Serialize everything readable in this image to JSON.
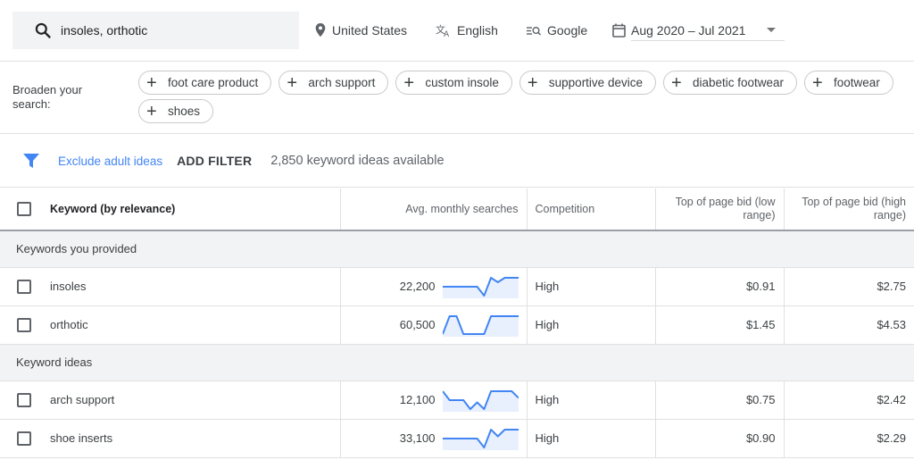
{
  "search": {
    "value": "insoles, orthotic",
    "icon": "search-icon"
  },
  "settings": {
    "location": "United States",
    "language": "English",
    "network": "Google",
    "date_range": "Aug 2020 – Jul 2021"
  },
  "broaden": {
    "label": "Broaden your search:",
    "chips": [
      "foot care product",
      "arch support",
      "custom insole",
      "supportive device",
      "diabetic footwear",
      "footwear",
      "shoes"
    ]
  },
  "filters": {
    "exclude_label": "Exclude adult ideas",
    "add_filter_label": "ADD FILTER",
    "count_text": "2,850 keyword ideas available"
  },
  "table": {
    "headers": {
      "keyword": "Keyword (by relevance)",
      "searches": "Avg. monthly searches",
      "competition": "Competition",
      "bid_low": "Top of page bid (low range)",
      "bid_high": "Top of page bid (high range)"
    },
    "groups": [
      {
        "title": "Keywords you provided",
        "rows": [
          {
            "keyword": "insoles",
            "searches": "22,200",
            "trend": [
              2,
              2,
              2,
              2,
              2,
              2,
              0,
              4,
              3,
              4,
              4,
              4
            ],
            "competition": "High",
            "bid_low": "$0.91",
            "bid_high": "$2.75"
          },
          {
            "keyword": "orthotic",
            "searches": "60,500",
            "trend": [
              1,
              4,
              4,
              1,
              1,
              1,
              1,
              4,
              4,
              4,
              4,
              4
            ],
            "competition": "High",
            "bid_low": "$1.45",
            "bid_high": "$4.53"
          }
        ]
      },
      {
        "title": "Keyword ideas",
        "rows": [
          {
            "keyword": "arch support",
            "searches": "12,100",
            "trend": [
              5,
              3,
              3,
              3,
              1,
              2.5,
              1,
              5,
              5,
              5,
              5,
              3.5
            ],
            "competition": "High",
            "bid_low": "$0.75",
            "bid_high": "$2.42"
          },
          {
            "keyword": "shoe inserts",
            "searches": "33,100",
            "trend": [
              2,
              2,
              2,
              2,
              2,
              2,
              0,
              4,
              2.5,
              4,
              4,
              4
            ],
            "competition": "High",
            "bid_low": "$0.90",
            "bid_high": "$2.29"
          }
        ]
      }
    ]
  },
  "colors": {
    "accent": "#4285f4",
    "spark_line": "#4285f4",
    "spark_fill": "#e8f0fe"
  }
}
